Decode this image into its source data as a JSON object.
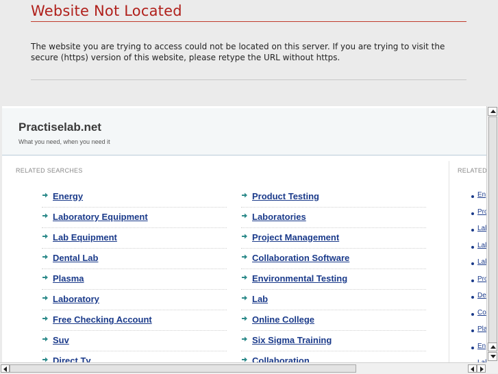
{
  "error": {
    "title": "Website Not Located",
    "message": "The website you are trying to access could not be located on this server. If you are trying to visit the secure (https) version of this website, please retype the URL without https."
  },
  "site": {
    "name": "Practiselab.net",
    "tagline": "What you need, when you need it"
  },
  "related": {
    "label": "RELATED SEARCHES",
    "label_truncated": "RELATED",
    "left": [
      "Energy",
      "Laboratory Equipment",
      "Lab Equipment",
      "Dental Lab",
      "Plasma",
      "Laboratory",
      "Free Checking Account",
      "Suv",
      "Direct Tv"
    ],
    "right": [
      "Product Testing",
      "Laboratories",
      "Project Management",
      "Collaboration Software",
      "Environmental Testing",
      "Lab",
      "Online College",
      "Six Sigma Training",
      "Collaboration"
    ],
    "side": [
      "En",
      "Pro",
      "Lal",
      "Lal",
      "Lal",
      "Pro",
      "De",
      "Co",
      "Pla",
      "En",
      "Lal"
    ]
  },
  "colors": {
    "error_red": "#b0201b",
    "link_blue": "#1a3a8a",
    "arrow_teal": "#2d8a8a"
  }
}
